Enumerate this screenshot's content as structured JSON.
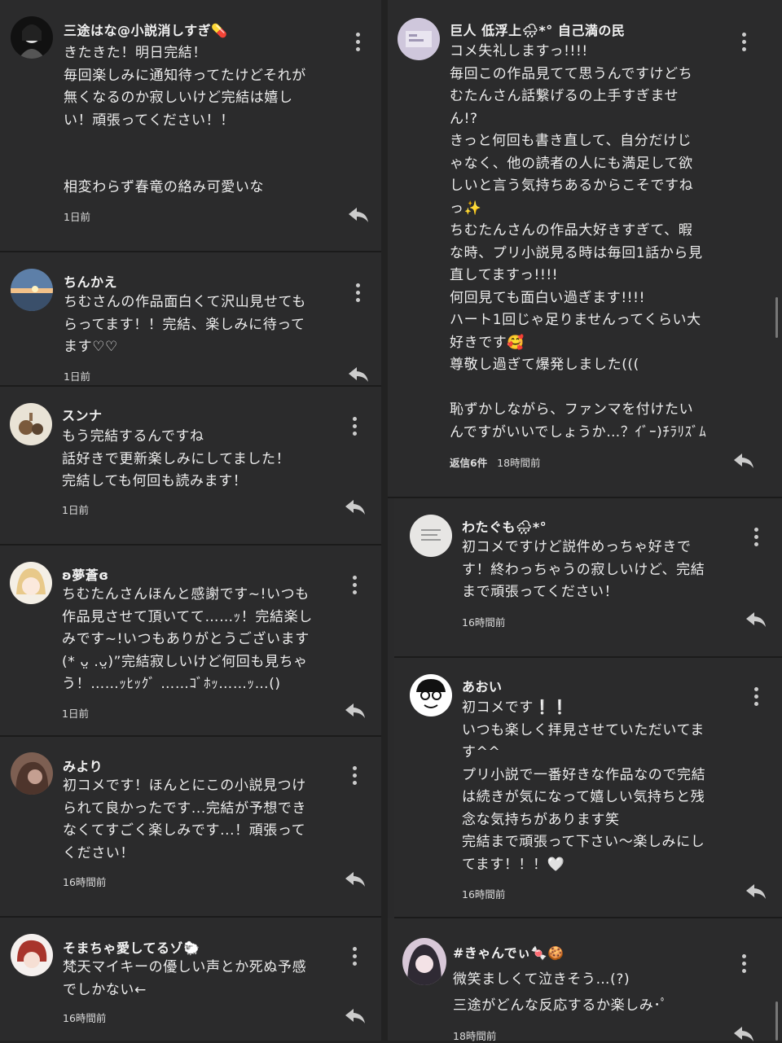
{
  "colors": {
    "background": "#222222",
    "card": "#2b2b2c",
    "text": "#ededed",
    "meta": "#dcdcdc",
    "icon": "#cccccc"
  },
  "left_comments": [
    {
      "name": "三途はな@小説消しすぎ💊",
      "text": "きたきた！明日完結！\n毎回楽しみに通知待ってたけどそれが\n無くなるのか寂しいけど完結は嬉し\nい！頑張ってください！！\n\n\n相変わらず春竜の絡み可愛いな",
      "time": "1日前",
      "avatar_icon": "user-avatar-monochrome"
    },
    {
      "name": "ちんかえ",
      "text": "ちむさんの作品面白くて沢山見せても\nらってます！！完結、楽しみに待って\nます♡♡",
      "time": "1日前",
      "avatar_icon": "user-avatar-sunset"
    },
    {
      "name": "スンナ",
      "text": "もう完結するんですね\n話好きで更新楽しみにしてました！\n完結しても何回も読みます！",
      "time": "1日前",
      "avatar_icon": "user-avatar-coffee"
    },
    {
      "name": "ʚ夢蒼ɞ",
      "text": "ちむたんさんほんと感謝です~!いつも\n作品見させて頂いてて……ｯ！完結楽し\nみです~!いつもありがとうございます\n(* ᴗ̤ .ᴗ̤)”完結寂しいけど何回も見ちゃ\nう！……ｯﾋｯｸﾞ ……ｺﾞﾎｯ……ｯ…()",
      "time": "1日前",
      "avatar_icon": "user-avatar-anime"
    },
    {
      "name": "みより",
      "text": "初コメです！ほんとにこの小説見つけ\nられて良かったです...完結が予想でき\nなくてすごく楽しみです...！頑張って\nください！",
      "time": "16時間前",
      "avatar_icon": "user-avatar-brown"
    },
    {
      "name": "そまちゃ愛してるゾ🐑",
      "text": "梵天マイキーの優しい声とか死ぬ予感\nでしかない←",
      "time": "16時間前",
      "avatar_icon": "user-avatar-redhair"
    }
  ],
  "right_comments": [
    {
      "name": "巨人 低浮上🌧*° 自己満の民",
      "text": "コメ失礼しますっ!!!!\n毎回この作品見てて思うんですけどち\nむたんさん話繋げるの上手すぎませ\nん!?\nきっと何回も書き直して、自分だけじ\nゃなく、他の読者の人にも満足して欲\nしいと言う気持ちあるからこそですね\nっ✨\nちむたんさんの作品大好きすぎて、暇\nな時、プリ小説見る時は毎回1話から見\n直してますっ!!!!\n何回見ても面白い過ぎます!!!!\nハート1回じゃ足りませんってくらい大\n好きです🥰\n尊敬し過ぎて爆発しました(((\n\n恥ずかしながら、ファンマを付けたい\nんですがいいでしょうか…？ｲﾞｰ)ﾁﾗﾘｽﾞﾑ",
      "replies": "返信6件",
      "time": "18時間前",
      "avatar_icon": "user-avatar-pastel"
    },
    {
      "name": "わたぐも🌧*°",
      "text": "初コメですけど説件めっちゃ好きで\nす！終わっちゃうの寂しいけど、完結\nまで頑張ってください！",
      "time": "16時間前",
      "avatar_icon": "user-avatar-cloud"
    },
    {
      "name": "あおい",
      "text": "初コメです❕❕\nいつも楽しく拝見させていただいてま\nす^^\nプリ小説で一番好きな作品なので完結\nは続きが気になって嬉しい気持ちと残\n念な気持ちがあります笑\n完結まで頑張って下さい〜楽しみにし\nてます！！！🤍",
      "time": "16時間前",
      "avatar_icon": "user-avatar-cartoon"
    },
    {
      "name": "#きゃんでぃ🍬🍪",
      "text": "微笑ましくて泣きそう…(?)\n三途がどんな反応するか楽しみ･ﾟ",
      "time": "18時間前",
      "avatar_icon": "user-avatar-pink"
    }
  ]
}
